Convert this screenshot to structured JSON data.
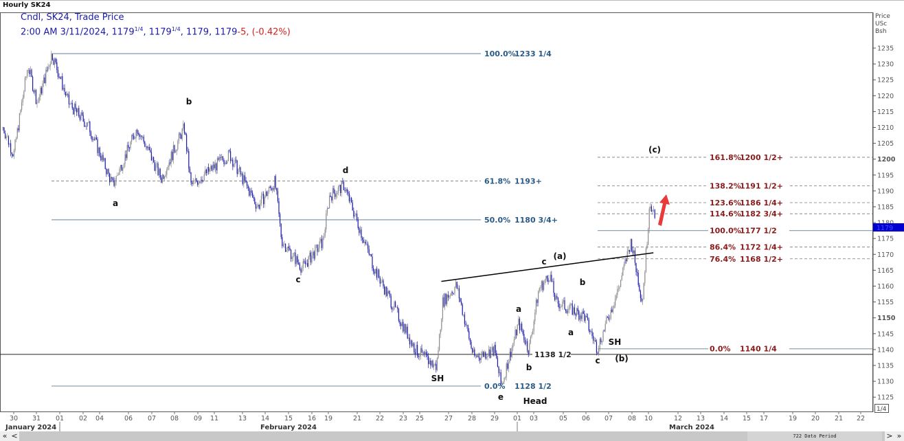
{
  "window": {
    "title": "Hourly SK24"
  },
  "legend": {
    "line1": "Cndl, SK24, Trade Price",
    "time": "2:00 AM 3/11/2024",
    "open": "1179",
    "open_frac": "1/4",
    "high": "1179",
    "high_frac": "1/4",
    "low": "1179",
    "close": "1179",
    "change": "-5",
    "change_pct": "(-0.42%)"
  },
  "footer": {
    "data_period": "722 Data Period",
    "first": "«",
    "prev": "<",
    "next": ">",
    "last": "»"
  },
  "chart_data": {
    "type": "candlestick",
    "title": "Hourly SK24",
    "ylabel": "Price USc Bsh",
    "ylim": [
      1122,
      1240
    ],
    "y_ticks": [
      1125,
      1130,
      1135,
      1140,
      1145,
      1150,
      1155,
      1160,
      1165,
      1170,
      1175,
      1180,
      1185,
      1190,
      1195,
      1200,
      1205,
      1210,
      1215,
      1220,
      1225,
      1230,
      1235
    ],
    "y_bold_ticks": [
      1150,
      1200
    ],
    "y_tick_unit": "1/4",
    "last_price": "1179",
    "x_ticks": [
      "30",
      "31",
      "01",
      "02",
      "04",
      "06",
      "07",
      "08",
      "09",
      "11",
      "13",
      "14",
      "15",
      "16",
      "19",
      "21",
      "22",
      "23",
      "25",
      "27",
      "28",
      "29",
      "01",
      "03",
      "05",
      "06",
      "07",
      "08",
      "10",
      "12",
      "13",
      "14",
      "15",
      "17",
      "19",
      "20",
      "21",
      "22"
    ],
    "months": [
      "January 2024",
      "February 2024",
      "March 2024"
    ],
    "price_path": [
      {
        "d": "01-29",
        "h": 13,
        "p": 1210
      },
      {
        "d": "01-30",
        "h": 0,
        "p": 1201.5
      },
      {
        "d": "01-30",
        "h": 15,
        "p": 1229.6
      },
      {
        "d": "01-31",
        "h": 1,
        "p": 1217.7
      },
      {
        "d": "01-31",
        "h": 16,
        "p": 1233.25
      },
      {
        "d": "02-01",
        "h": 9,
        "p": 1217.7
      },
      {
        "d": "02-02",
        "h": 9,
        "p": 1210
      },
      {
        "d": "02-04",
        "h": 11,
        "p": 1191.7
      },
      {
        "d": "02-06",
        "h": 9,
        "p": 1210
      },
      {
        "d": "02-07",
        "h": 10,
        "p": 1193.9
      },
      {
        "d": "02-08",
        "h": 10,
        "p": 1210
      },
      {
        "d": "02-08",
        "h": 17,
        "p": 1191.7
      },
      {
        "d": "02-11",
        "h": 13,
        "p": 1201.5
      },
      {
        "d": "02-13",
        "h": 16,
        "p": 1185
      },
      {
        "d": "02-14",
        "h": 10,
        "p": 1193
      },
      {
        "d": "02-14",
        "h": 17,
        "p": 1174.4
      },
      {
        "d": "02-15",
        "h": 14,
        "p": 1165.7
      },
      {
        "d": "02-16",
        "h": 16,
        "p": 1174
      },
      {
        "d": "02-19",
        "h": 1,
        "p": 1188.5
      },
      {
        "d": "02-19",
        "h": 13,
        "p": 1191.7
      },
      {
        "d": "02-21",
        "h": 18,
        "p": 1165.7
      },
      {
        "d": "02-23",
        "h": 18,
        "p": 1139.8
      },
      {
        "d": "02-25",
        "h": 14,
        "p": 1134.4
      },
      {
        "d": "02-25",
        "h": 19,
        "p": 1155
      },
      {
        "d": "02-27",
        "h": 8,
        "p": 1160.3
      },
      {
        "d": "02-28",
        "h": 2,
        "p": 1137.6
      },
      {
        "d": "02-29",
        "h": 0,
        "p": 1139.8
      },
      {
        "d": "02-29",
        "h": 7,
        "p": 1128.5
      },
      {
        "d": "03-01",
        "h": 2,
        "p": 1148.4
      },
      {
        "d": "03-01",
        "h": 17,
        "p": 1139.8
      },
      {
        "d": "03-03",
        "h": 4,
        "p": 1159
      },
      {
        "d": "03-03",
        "h": 13,
        "p": 1163.6
      },
      {
        "d": "03-03",
        "h": 18,
        "p": 1155
      },
      {
        "d": "03-05",
        "h": 22,
        "p": 1150.6
      },
      {
        "d": "03-06",
        "h": 12,
        "p": 1140.25
      },
      {
        "d": "03-07",
        "h": 10,
        "p": 1159
      },
      {
        "d": "03-07",
        "h": 23,
        "p": 1174.4
      },
      {
        "d": "03-08",
        "h": 15,
        "p": 1155
      },
      {
        "d": "03-08",
        "h": 23,
        "p": 1177.6
      },
      {
        "d": "03-10",
        "h": 1,
        "p": 1187.4
      },
      {
        "d": "03-10",
        "h": 6,
        "p": 1179.25
      }
    ],
    "fib_left": [
      {
        "label": "100.0%",
        "value": "1233 1/4",
        "price": 1233.25,
        "style": "solid"
      },
      {
        "label": "61.8%",
        "value": "1193+",
        "price": 1193.1,
        "style": "dashed"
      },
      {
        "label": "50.0%",
        "value": "1180 3/4+",
        "price": 1180.9,
        "style": "solid"
      },
      {
        "label": "0.0%",
        "value": "1128 1/2",
        "price": 1128.5,
        "style": "solid"
      }
    ],
    "fib_right": [
      {
        "label": "161.8%",
        "value": "1200 1/2+",
        "price": 1200.6,
        "style": "dashed"
      },
      {
        "label": "138.2%",
        "value": "1191 1/2+",
        "price": 1191.6,
        "style": "dashed"
      },
      {
        "label": "123.6%",
        "value": "1186 1/4+",
        "price": 1186.3,
        "style": "dashed"
      },
      {
        "label": "114.6%",
        "value": "1182 3/4+",
        "price": 1182.8,
        "style": "dashed"
      },
      {
        "label": "100.0%",
        "value": "1177 1/2",
        "price": 1177.5,
        "style": "solid"
      },
      {
        "label": "86.4%",
        "value": "1172 1/4+",
        "price": 1172.3,
        "style": "dashed"
      },
      {
        "label": "76.4%",
        "value": "1168 1/2+",
        "price": 1168.6,
        "style": "dashed"
      },
      {
        "label": "0.0%",
        "value": "1140 1/4",
        "price": 1140.25,
        "style": "solid"
      }
    ],
    "support": {
      "value": "1138 1/2",
      "price": 1138.5
    },
    "trendline": [
      {
        "d": "02-25",
        "h": 18,
        "p": 1161.5
      },
      {
        "d": "03-10",
        "h": 4,
        "p": 1170.5
      }
    ],
    "annotations": [
      "b",
      "a",
      "c",
      "d",
      "SH",
      "e",
      "Head",
      "a",
      "b",
      "c",
      "(a)",
      "b",
      "a",
      "c",
      "SH",
      "(b)",
      "(c)"
    ],
    "colors": {
      "down": "#1a1aa8",
      "up": "#8a8a8a",
      "fib_left": "#2a5a86",
      "fib_right": "#8b1a1a",
      "arrow": "#e83a3a",
      "last_price_bg": "#0000d0"
    }
  }
}
